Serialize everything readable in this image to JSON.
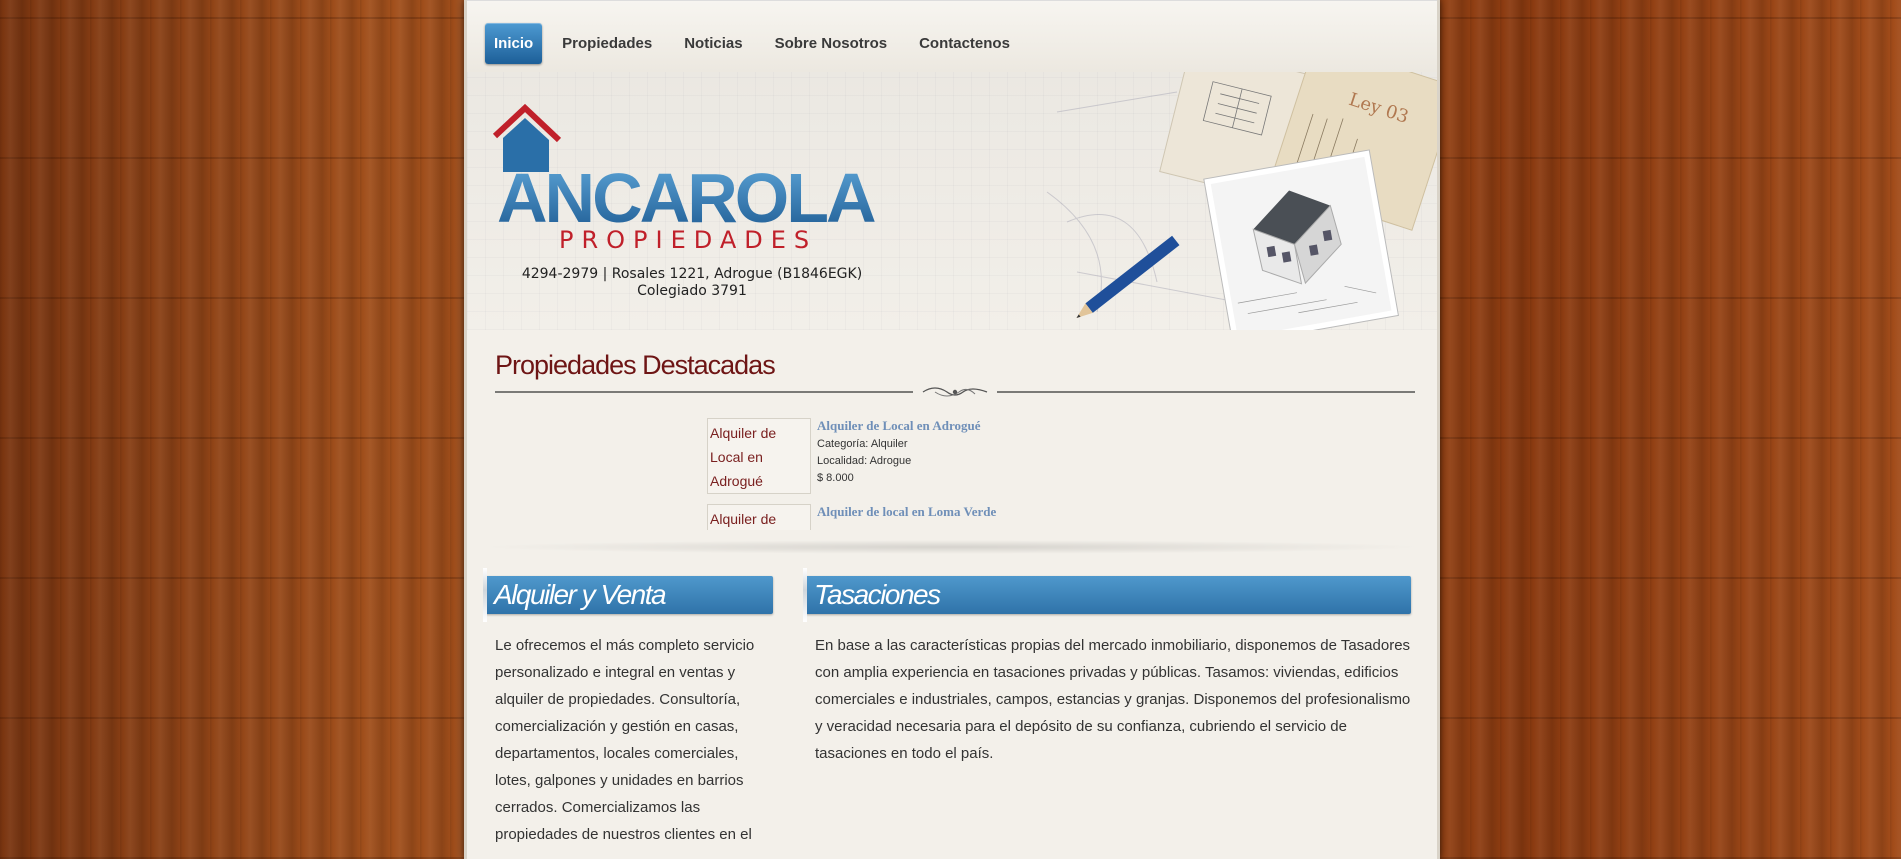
{
  "nav": {
    "items": [
      {
        "label": "Inicio",
        "active": true
      },
      {
        "label": "Propiedades"
      },
      {
        "label": "Noticias"
      },
      {
        "label": "Sobre Nosotros"
      },
      {
        "label": "Contactenos"
      }
    ]
  },
  "brand": {
    "name": "ANCAROLA",
    "sub": "PROPIEDADES",
    "contact_line1": "4294-2979 | Rosales 1221, Adrogue (B1846EGK)",
    "contact_line2": "Colegiado 3791",
    "sketch_text": "Ley 03"
  },
  "featured": {
    "title": "Propiedades Destacadas",
    "items": [
      {
        "image_alt": "Alquiler de Local en Adrogué",
        "title": "Alquiler de Local en Adrogué",
        "category": "Categoría: Alquiler",
        "location": "Localidad: Adrogue",
        "price": "$ 8.000"
      },
      {
        "image_alt": "Alquiler de",
        "title": "Alquiler de local en Loma Verde"
      }
    ]
  },
  "sections": {
    "left": {
      "title": "Alquiler y Venta",
      "body": "Le ofrecemos el más completo servicio personalizado e integral en ventas y alquiler de propiedades. Consultoría, comercialización y gestión en casas, departamentos, locales comerciales, lotes, galpones y unidades en barrios cerrados. Comercializamos las propiedades de nuestros clientes en el"
    },
    "right": {
      "title": "Tasaciones",
      "body": "En base a las características propias del mercado inmobiliario, disponemos de Tasadores con amplia experiencia en tasaciones privadas y públicas. Tasamos: viviendas, edificios comerciales e industriales, campos, estancias y granjas. Disponemos del profesionalismo y veracidad necesaria para el depósito de su confianza, cubriendo el servicio de tasaciones en todo el país."
    }
  },
  "colors": {
    "brand_blue": "#2a6fa8",
    "brand_red": "#c0202a",
    "title_red": "#6e1515",
    "link_blue": "#6f8fb8"
  }
}
